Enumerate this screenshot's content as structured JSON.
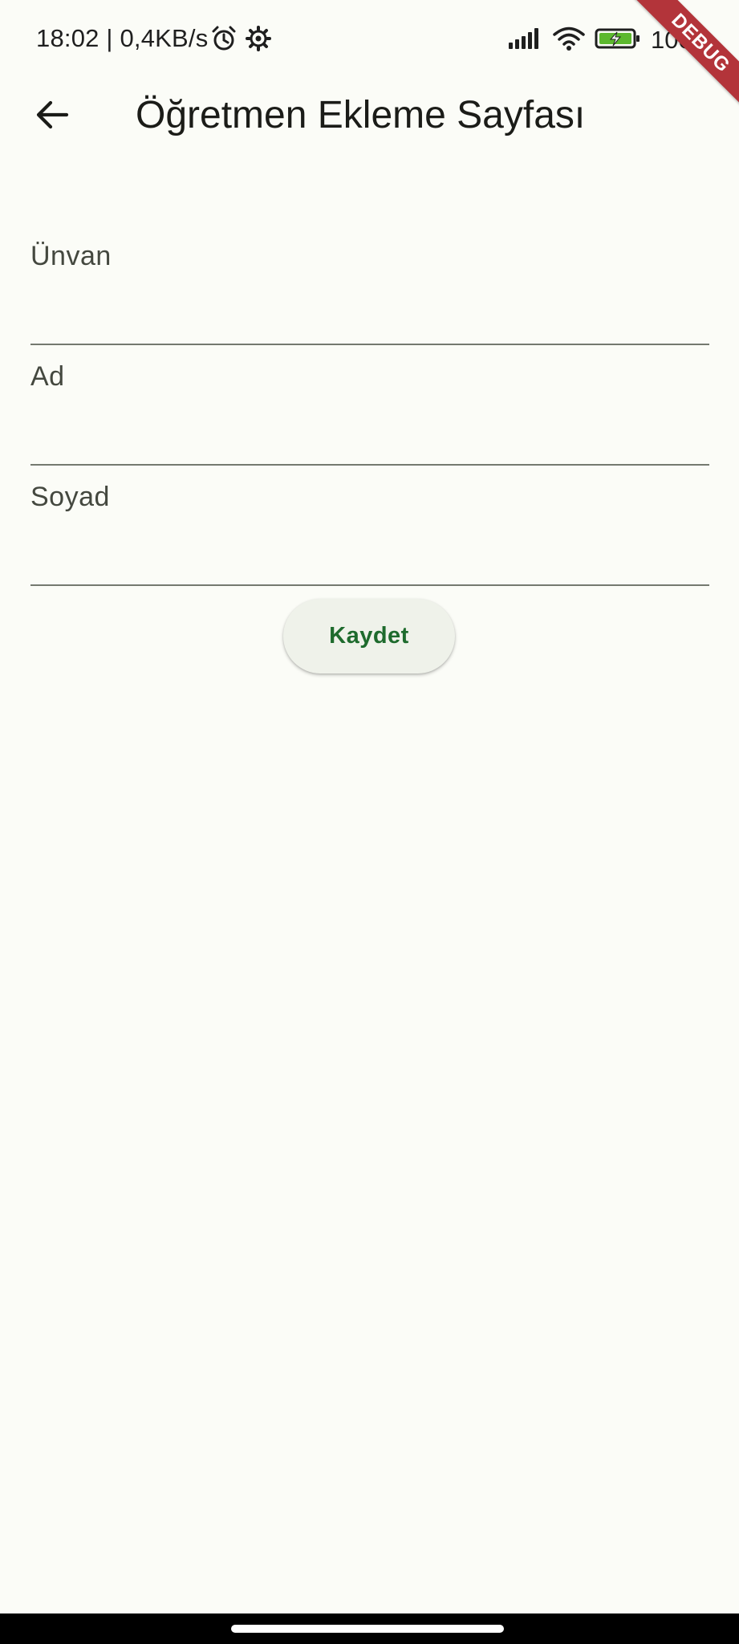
{
  "status_bar": {
    "time_speed": "18:02 | 0,4KB/s",
    "battery_percent": "100",
    "icons": [
      "alarm-icon",
      "settings-icon",
      "signal-icon",
      "wifi-icon",
      "battery-charging-icon"
    ]
  },
  "debug_banner": {
    "label": "DEBUG",
    "color": "#b3343a"
  },
  "app_bar": {
    "back_icon": "arrow-back-icon",
    "title": "Öğretmen Ekleme Sayfası"
  },
  "form": {
    "fields": [
      {
        "label": "Ünvan",
        "value": ""
      },
      {
        "label": "Ad",
        "value": ""
      },
      {
        "label": "Soyad",
        "value": ""
      }
    ],
    "save_label": "Kaydet"
  },
  "colors": {
    "background": "#fbfcf7",
    "accent": "#1e6b2d",
    "button_bg": "#eff2ea",
    "divider": "#74796f"
  }
}
